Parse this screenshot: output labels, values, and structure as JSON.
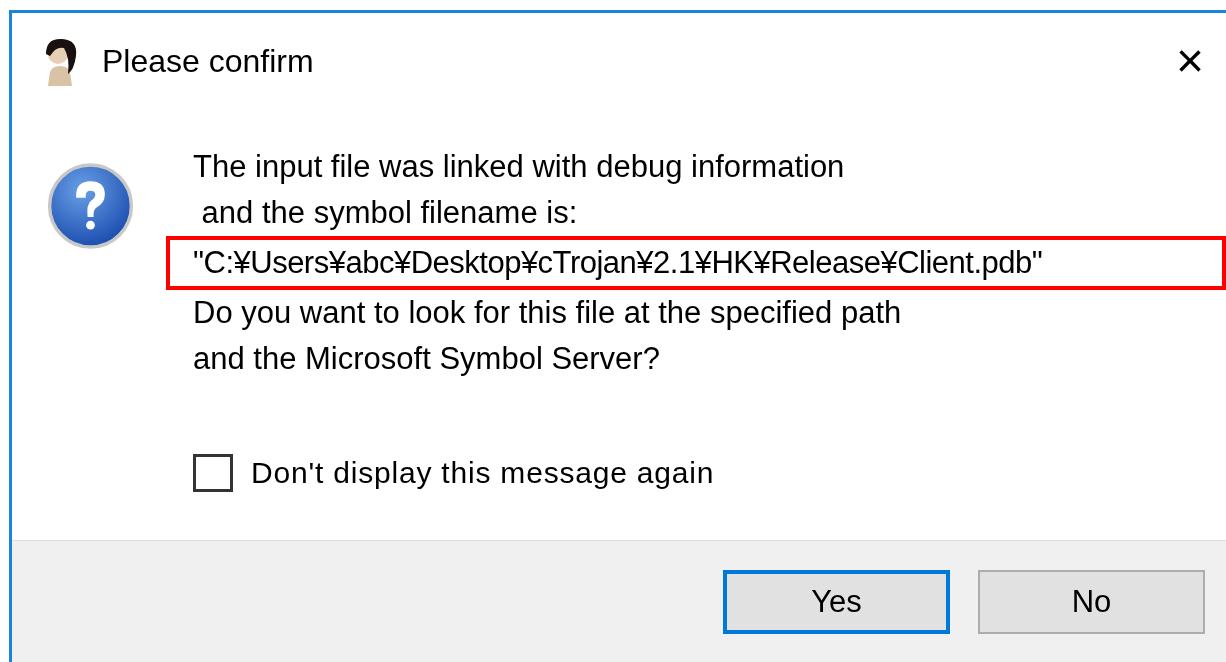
{
  "window": {
    "title": "Please confirm",
    "close": "×"
  },
  "message": {
    "lines": [
      {
        "text": "The input file was linked with debug information",
        "highlighted": false
      },
      {
        "text": " and the symbol filename is:",
        "highlighted": false
      },
      {
        "text": "\"C:¥Users¥abc¥Desktop¥cTrojan¥2.1¥HK¥Release¥Client.pdb\"",
        "highlighted": true
      },
      {
        "text": "Do you want to look for this file at the specified path",
        "highlighted": false
      },
      {
        "text": "and the Microsoft Symbol Server?",
        "highlighted": false
      }
    ]
  },
  "checkbox": {
    "label": "Don't display this message again",
    "checked": false
  },
  "buttons": [
    {
      "label": "Yes",
      "selected": true
    },
    {
      "label": "No",
      "selected": false
    }
  ]
}
